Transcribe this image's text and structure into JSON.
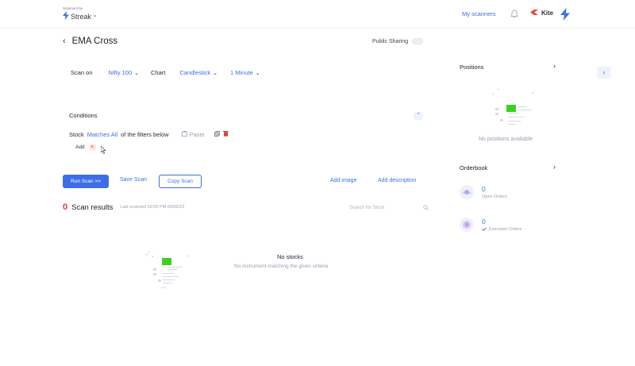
{
  "header": {
    "scanners_by": "Scanners by",
    "brand_name": "Streak",
    "trademark": "™",
    "my_scanners": "My scanners",
    "kite_label": "Kite"
  },
  "scan": {
    "title": "EMA Cross",
    "public_sharing_label": "Public Sharing",
    "scan_on_label": "Scan on",
    "scan_on_value": "Nifty 100",
    "chart_label": "Chart",
    "chart_type": "Candlestick",
    "interval": "1 Minute"
  },
  "conditions": {
    "title": "Conditions",
    "stock_label": "Stock",
    "match_value": "Matches All",
    "of_filters": "of the filters below",
    "paste_label": "Paste",
    "add_label": "Add"
  },
  "actions": {
    "run_scan": "Run Scan >>",
    "save_scan": "Save Scan",
    "copy_scan": "Copy Scan",
    "add_image": "Add image",
    "add_description": "Add description"
  },
  "results": {
    "count": "0",
    "title": "Scan results",
    "last_scan": "Last scanned 02:05 PM 03/09/23",
    "search_placeholder": "Search for Stock",
    "empty_title": "No stocks",
    "empty_subtitle": "No instrument matching the given criteria"
  },
  "positions": {
    "title": "Positions",
    "empty_text": "No positions available"
  },
  "orderbook": {
    "title": "Orderbook",
    "open_count": "0",
    "open_label": "Open Orders",
    "executed_count": "0",
    "executed_label": "Executed Orders"
  },
  "colors": {
    "accent": "#3d6ee8",
    "danger": "#e0403a",
    "illustration_green": "#3ad11f"
  }
}
